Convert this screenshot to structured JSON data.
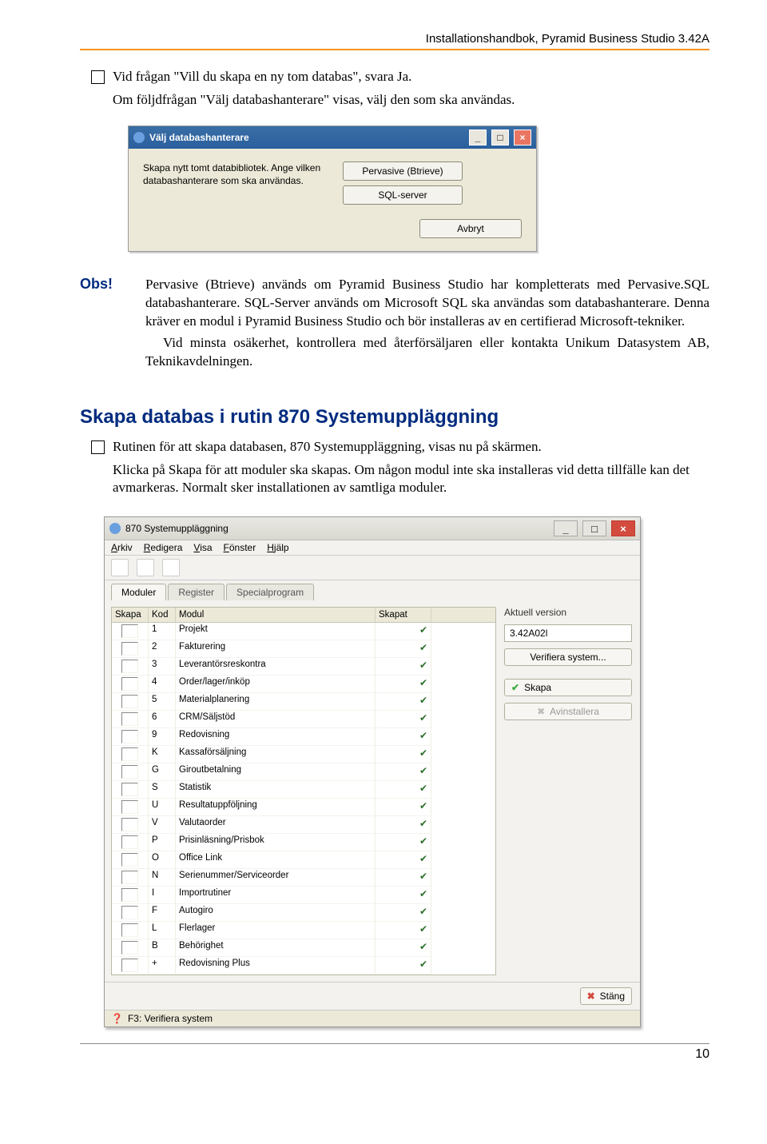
{
  "header": "Installationshandbok, Pyramid Business Studio 3.42A",
  "page_number": "10",
  "intro": {
    "line1": "Vid frågan \"Vill du skapa en ny tom databas\", svara Ja.",
    "line2": "Om följdfrågan \"Välj databashanterare\" visas, välj den som ska användas."
  },
  "dlg1": {
    "title": "Välj databashanterare",
    "body": "Skapa nytt tomt databibliotek. Ange vilken databashanterare som ska användas.",
    "btn_pervasive": "Pervasive (Btrieve)",
    "btn_sql": "SQL-server",
    "btn_cancel": "Avbryt"
  },
  "obs": {
    "label": "Obs!",
    "p1": "Pervasive (Btrieve) används om Pyramid Business Studio har kompletterats med Pervasive.SQL databashanterare. SQL-Server används om Microsoft SQL ska användas som databashanterare. Denna kräver en modul i Pyramid Business Studio och bör installeras av en certifierad Microsoft-tekniker.",
    "p2": "Vid minsta osäkerhet, kontrollera med återförsäljaren eller kontakta Unikum Datasystem AB, Teknikavdelningen."
  },
  "section_heading": "Skapa databas i rutin 870 Systemuppläggning",
  "rutin": {
    "line1": "Rutinen för att skapa databasen, 870 Systemuppläggning, visas nu på skärmen.",
    "line2": "Klicka på Skapa för att moduler ska skapas. Om någon modul inte ska installeras vid detta tillfälle kan det avmarkeras. Normalt sker installationen av samtliga moduler."
  },
  "dlg2": {
    "title": "870 Systemuppläggning",
    "menu": {
      "arkiv": "Arkiv",
      "redigera": "Redigera",
      "visa": "Visa",
      "fonster": "Fönster",
      "hjalp": "Hjälp"
    },
    "tabs": {
      "moduler": "Moduler",
      "register": "Register",
      "specialprogram": "Specialprogram"
    },
    "columns": {
      "skapa": "Skapa",
      "kod": "Kod",
      "modul": "Modul",
      "skapat": "Skapat"
    },
    "rows": [
      {
        "kod": "1",
        "modul": "Projekt"
      },
      {
        "kod": "2",
        "modul": "Fakturering"
      },
      {
        "kod": "3",
        "modul": "Leverantörsreskontra"
      },
      {
        "kod": "4",
        "modul": "Order/lager/inköp"
      },
      {
        "kod": "5",
        "modul": "Materialplanering"
      },
      {
        "kod": "6",
        "modul": "CRM/Säljstöd"
      },
      {
        "kod": "9",
        "modul": "Redovisning"
      },
      {
        "kod": "K",
        "modul": "Kassaförsäljning"
      },
      {
        "kod": "G",
        "modul": "Giroutbetalning"
      },
      {
        "kod": "S",
        "modul": "Statistik"
      },
      {
        "kod": "U",
        "modul": "Resultatuppföljning"
      },
      {
        "kod": "V",
        "modul": "Valutaorder"
      },
      {
        "kod": "P",
        "modul": "Prisinläsning/Prisbok"
      },
      {
        "kod": "O",
        "modul": "Office Link"
      },
      {
        "kod": "N",
        "modul": "Serienummer/Serviceorder"
      },
      {
        "kod": "I",
        "modul": "Importrutiner"
      },
      {
        "kod": "F",
        "modul": "Autogiro"
      },
      {
        "kod": "L",
        "modul": "Flerlager"
      },
      {
        "kod": "B",
        "modul": "Behörighet"
      },
      {
        "kod": "+",
        "modul": "Redovisning Plus"
      }
    ],
    "side": {
      "label": "Aktuell version",
      "version": "3.42A02l",
      "verify": "Verifiera system...",
      "skapa": "Skapa",
      "avinstallera": "Avinstallera"
    },
    "close": "Stäng",
    "status": "F3: Verifiera system"
  }
}
